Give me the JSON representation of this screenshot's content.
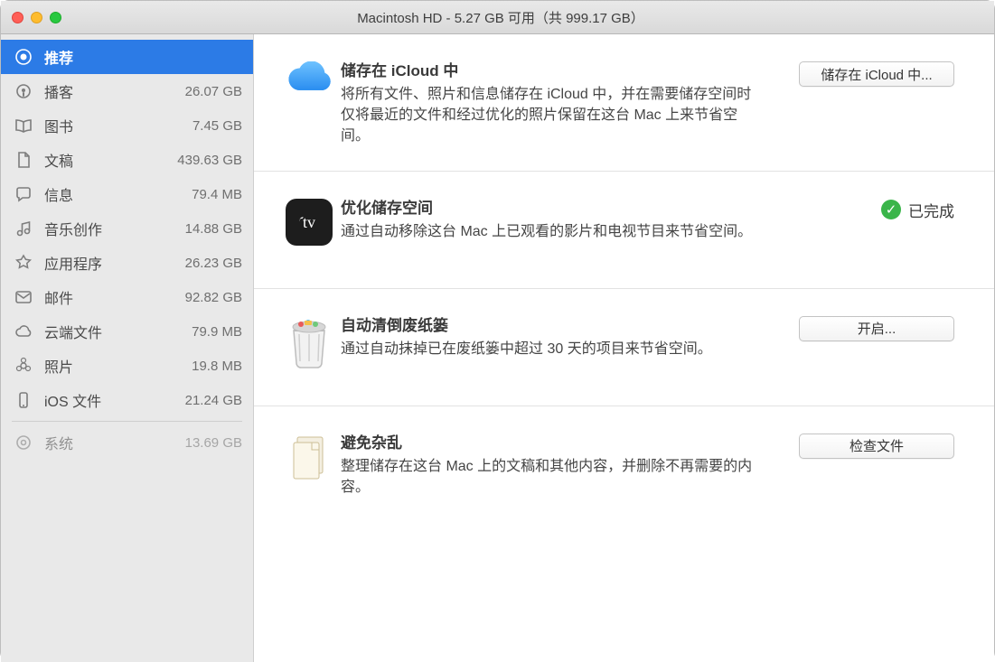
{
  "window": {
    "title": "Macintosh HD - 5.27 GB 可用（共 999.17 GB）"
  },
  "sidebar": {
    "recommended_label": "推荐",
    "items": [
      {
        "label": "播客",
        "size": "26.07 GB",
        "icon": "podcasts"
      },
      {
        "label": "图书",
        "size": "7.45 GB",
        "icon": "books"
      },
      {
        "label": "文稿",
        "size": "439.63 GB",
        "icon": "documents"
      },
      {
        "label": "信息",
        "size": "79.4 MB",
        "icon": "messages"
      },
      {
        "label": "音乐创作",
        "size": "14.88 GB",
        "icon": "music-creation"
      },
      {
        "label": "应用程序",
        "size": "26.23 GB",
        "icon": "apps"
      },
      {
        "label": "邮件",
        "size": "92.82 GB",
        "icon": "mail"
      },
      {
        "label": "云端文件",
        "size": "79.9 MB",
        "icon": "cloud"
      },
      {
        "label": "照片",
        "size": "19.8 MB",
        "icon": "photos"
      },
      {
        "label": "iOS 文件",
        "size": "21.24 GB",
        "icon": "ios"
      }
    ],
    "system_label": "系统",
    "system_size": "13.69 GB"
  },
  "recs": {
    "icloud": {
      "title": "储存在 iCloud 中",
      "desc": "将所有文件、照片和信息储存在 iCloud 中，并在需要储存空间时仅将最近的文件和经过优化的照片保留在这台 Mac 上来节省空间。",
      "button": "储存在 iCloud 中..."
    },
    "optimize": {
      "title": "优化储存空间",
      "desc": "通过自动移除这台 Mac 上已观看的影片和电视节目来节省空间。",
      "status": "已完成"
    },
    "trash": {
      "title": "自动清倒废纸篓",
      "desc": "通过自动抹掉已在废纸篓中超过 30 天的项目来节省空间。",
      "button": "开启..."
    },
    "clutter": {
      "title": "避免杂乱",
      "desc": "整理储存在这台 Mac 上的文稿和其他内容，并删除不再需要的内容。",
      "button": "检查文件"
    }
  }
}
